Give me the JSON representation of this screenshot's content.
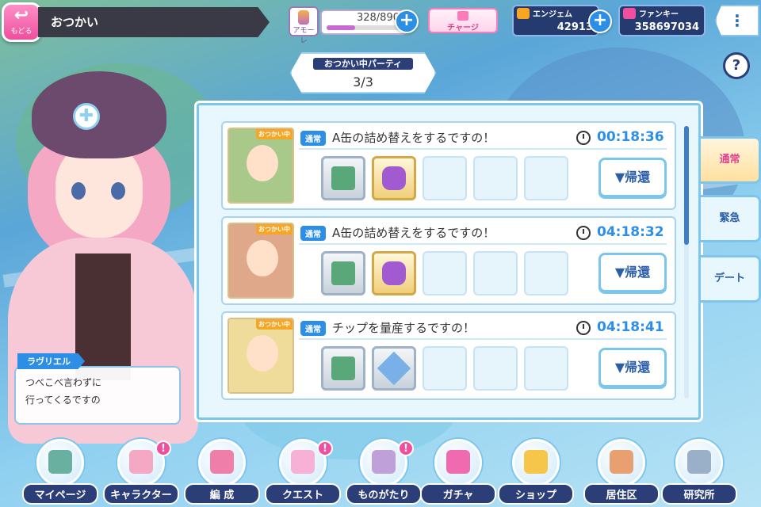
{
  "header": {
    "back_label": "もどる",
    "title": "おつかい",
    "amore": {
      "label": "アモーレ",
      "value": "328/890",
      "fill": 0.37
    },
    "charge_label": "チャージ",
    "currencies": [
      {
        "name": "エンジェム",
        "value": "42913",
        "color": "#f6a623"
      },
      {
        "name": "ファンキー",
        "value": "358697034",
        "color": "#ef4f9e"
      }
    ]
  },
  "party": {
    "label": "おつかい中パーティ",
    "value": "3/3"
  },
  "help_icon": "?",
  "speaker": {
    "name": "ラヴリエル",
    "line1": "つべこべ言わずに",
    "line2": "行ってくるですの"
  },
  "missions": [
    {
      "type": "通常",
      "status": "おつかい中",
      "title": "A缶の詰め替えをするですの！",
      "time": "00:18:36",
      "return": "▼帰還",
      "items": [
        "chip-item",
        "a-can-item"
      ],
      "portrait_color": "#a8c98a"
    },
    {
      "type": "通常",
      "status": "おつかい中",
      "title": "A缶の詰め替えをするですの！",
      "time": "04:18:32",
      "return": "▼帰還",
      "items": [
        "chip-item",
        "a-can-item"
      ],
      "portrait_color": "#e0a88a"
    },
    {
      "type": "通常",
      "status": "おつかい中",
      "title": "チップを量産するですの！",
      "time": "04:18:41",
      "return": "▼帰還",
      "items": [
        "chip-item",
        "crystal-item"
      ],
      "portrait_color": "#f0dc9a"
    }
  ],
  "tabs": [
    {
      "label": "通常"
    },
    {
      "label": "緊急"
    },
    {
      "label": "デート"
    }
  ],
  "nav": [
    {
      "label": "マイページ",
      "badge": "",
      "color": "#6ab0a0"
    },
    {
      "label": "キャラクター",
      "badge": "!",
      "color": "#f4a8c4"
    },
    {
      "label": "編 成",
      "badge": "",
      "color": "#ef7fa8"
    },
    {
      "label": "クエスト",
      "badge": "!",
      "color": "#f7b0d6"
    },
    {
      "label": "ものがたり",
      "badge": "!",
      "color": "#c0a0d8"
    },
    {
      "label": "ガチャ",
      "badge": "",
      "color": "#f06ab0"
    },
    {
      "label": "ショップ",
      "badge": "",
      "color": "#f6c64a"
    },
    {
      "label": "居住区",
      "badge": "",
      "color": "#e8a070"
    },
    {
      "label": "研究所",
      "badge": "",
      "color": "#9ab0c8"
    }
  ]
}
